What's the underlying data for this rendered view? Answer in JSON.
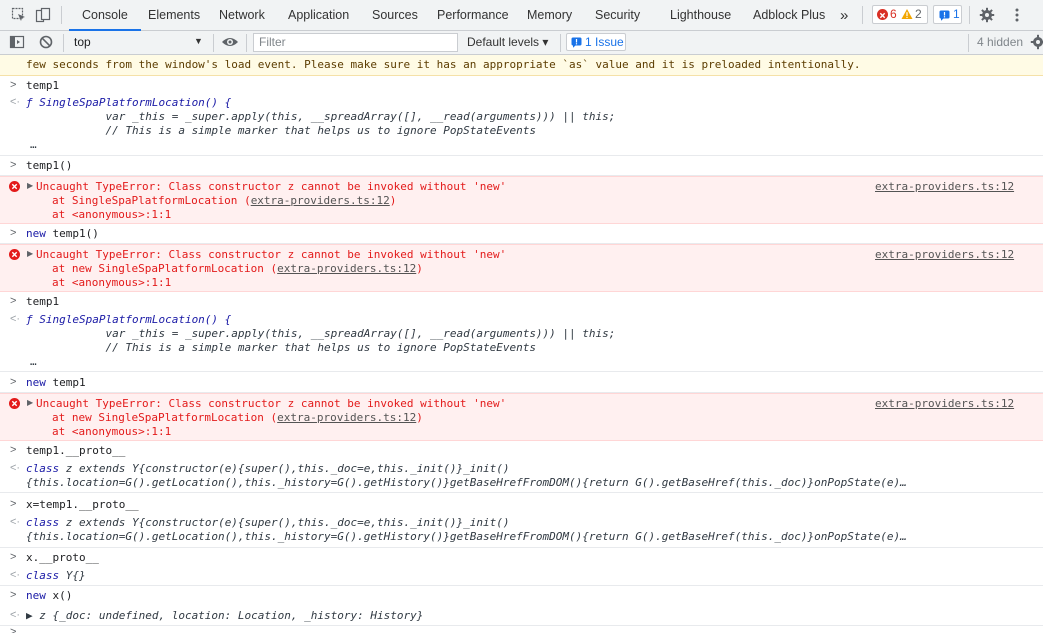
{
  "tabs": [
    "Console",
    "Elements",
    "Network",
    "Application",
    "Sources",
    "Performance",
    "Memory",
    "Security",
    "Lighthouse",
    "Adblock Plus"
  ],
  "more_tabs": "»",
  "counters": {
    "errors": "6",
    "warnings": "2",
    "issues_badge": "1"
  },
  "toolbar": {
    "context": "top",
    "filter_placeholder": "Filter",
    "levels": "Default levels ▾",
    "issue_button": "1 Issue",
    "hidden": "4 hidden"
  },
  "warning": {
    "text": "few seconds from the window's load event. Please make sure it has an appropriate `as` value and it is preloaded intentionally."
  },
  "entries": {
    "e1": {
      "input": "temp1",
      "l1": "ƒ SingleSpaPlatformLocation() {",
      "l2": "            var _this = _super.apply(this, __spreadArray([], __read(arguments))) || this;",
      "l3": "            // This is a simple marker that helps us to ignore PopStateEvents",
      "l4": "…"
    },
    "e2": {
      "input": "temp1()"
    },
    "e3": {
      "msg": "Uncaught TypeError: Class constructor z cannot be invoked without 'new'",
      "at1": "at SingleSpaPlatformLocation ",
      "src1": "extra-providers.ts:12",
      "at2": "at <anonymous>:1:1",
      "link": "extra-providers.ts:12"
    },
    "e4": {
      "kw": "new",
      "input": " temp1()"
    },
    "e5": {
      "msg": "Uncaught TypeError: Class constructor z cannot be invoked without 'new'",
      "at1": "at new SingleSpaPlatformLocation ",
      "src1": "extra-providers.ts:12",
      "at2": "at <anonymous>:1:1",
      "link": "extra-providers.ts:12"
    },
    "e6": {
      "input": "temp1",
      "l1": "ƒ SingleSpaPlatformLocation() {",
      "l2": "            var _this = _super.apply(this, __spreadArray([], __read(arguments))) || this;",
      "l3": "            // This is a simple marker that helps us to ignore PopStateEvents",
      "l4": "…"
    },
    "e7": {
      "kw": "new",
      "input": " temp1"
    },
    "e8": {
      "msg": "Uncaught TypeError: Class constructor z cannot be invoked without 'new'",
      "at1": "at new SingleSpaPlatformLocation ",
      "src1": "extra-providers.ts:12",
      "at2": "at <anonymous>:1:1",
      "link": "extra-providers.ts:12"
    },
    "e9": {
      "input": "temp1.__proto__",
      "kw": "class",
      "l1": " z extends Y{constructor(e){super(),this._doc=e,this._init()}_init()",
      "l2": "{this.location=G().getLocation(),this._history=G().getHistory()}getBaseHrefFromDOM(){return G().getBaseHref(this._doc)}onPopState(e)…"
    },
    "e10": {
      "input": "x=temp1.__proto__",
      "kw": "class",
      "l1": " z extends Y{constructor(e){super(),this._doc=e,this._init()}_init()",
      "l2": "{this.location=G().getLocation(),this._history=G().getHistory()}getBaseHrefFromDOM(){return G().getBaseHref(this._doc)}onPopState(e)…"
    },
    "e11": {
      "input": "x.__proto__",
      "kw": "class",
      "l1": " Y{}"
    },
    "e12": {
      "kw": "new",
      "input": " x()",
      "result": "▶ z {_doc: undefined, location: Location, _history: History}"
    }
  }
}
